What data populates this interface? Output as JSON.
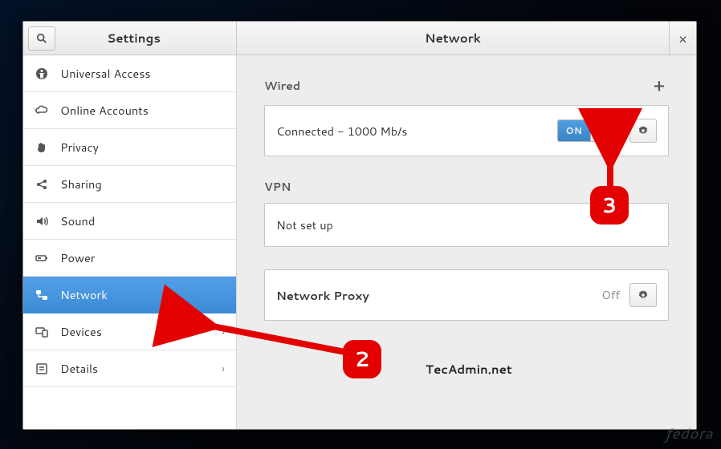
{
  "header": {
    "left_title": "Settings",
    "right_title": "Network"
  },
  "sidebar": {
    "items": [
      {
        "icon": "accessibility",
        "label": "Universal Access"
      },
      {
        "icon": "online",
        "label": "Online Accounts"
      },
      {
        "icon": "privacy",
        "label": "Privacy"
      },
      {
        "icon": "sharing",
        "label": "Sharing"
      },
      {
        "icon": "sound",
        "label": "Sound"
      },
      {
        "icon": "power",
        "label": "Power"
      },
      {
        "icon": "network",
        "label": "Network"
      },
      {
        "icon": "devices",
        "label": "Devices"
      },
      {
        "icon": "details",
        "label": "Details"
      }
    ],
    "active_index": 6,
    "chevron_indices": [
      7,
      8
    ]
  },
  "sections": {
    "wired": {
      "title": "Wired",
      "status": "Connected - 1000 Mb/s",
      "switch_label": "ON"
    },
    "vpn": {
      "title": "VPN",
      "status": "Not set up"
    },
    "proxy": {
      "title": "Network Proxy",
      "state": "Off"
    }
  },
  "callouts": {
    "step2": "2",
    "step3": "3"
  },
  "watermark": "TecAdmin.net",
  "fedora": "fedora"
}
